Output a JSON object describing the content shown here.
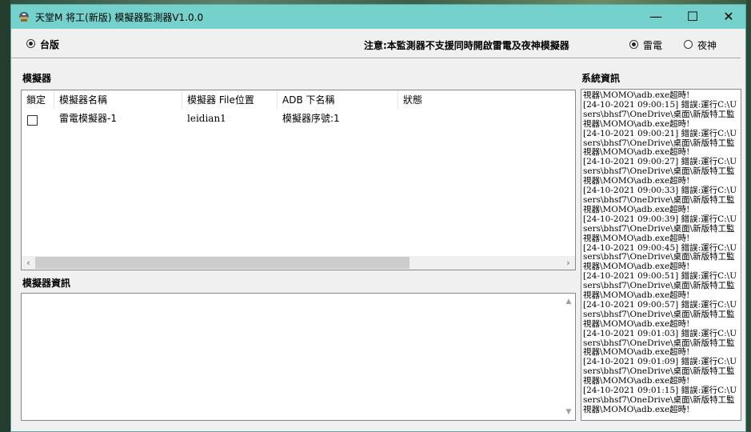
{
  "window": {
    "title": "天堂M 将工(新版) 模擬器監測器V1.0.0",
    "minimize": "—",
    "maximize": "☐",
    "close": "✕"
  },
  "region": {
    "option_taiwan": "台版",
    "notice": "注意:本監測器不支援同時開啟雷電及夜神模擬器",
    "option_leidian": "雷電",
    "option_nox": "夜神"
  },
  "emulator_section": {
    "title": "模擬器",
    "columns": [
      "鎖定",
      "模擬器名稱",
      "模擬器 File位置",
      "ADB 下名稱",
      "狀態"
    ],
    "rows": [
      {
        "locked": false,
        "name": "雷電模擬器-1",
        "file": "leidian1",
        "adb": "模擬器序號:1",
        "status": ""
      }
    ]
  },
  "emulator_info": {
    "title": "模擬器資訊",
    "content": ""
  },
  "system_info": {
    "title": "系統資訊",
    "log": "視器\\MOMO\\adb.exe超時!\n[24-10-2021 09:00:15] 錯誤:運行C:\\Users\\bhsf7\\OneDrive\\桌面\\新版特工監視器\\MOMO\\adb.exe超時!\n[24-10-2021 09:00:21] 錯誤:運行C:\\Users\\bhsf7\\OneDrive\\桌面\\新版特工監視器\\MOMO\\adb.exe超時!\n[24-10-2021 09:00:27] 錯誤:運行C:\\Users\\bhsf7\\OneDrive\\桌面\\新版特工監視器\\MOMO\\adb.exe超時!\n[24-10-2021 09:00:33] 錯誤:運行C:\\Users\\bhsf7\\OneDrive\\桌面\\新版特工監視器\\MOMO\\adb.exe超時!\n[24-10-2021 09:00:39] 錯誤:運行C:\\Users\\bhsf7\\OneDrive\\桌面\\新版特工監視器\\MOMO\\adb.exe超時!\n[24-10-2021 09:00:45] 錯誤:運行C:\\Users\\bhsf7\\OneDrive\\桌面\\新版特工監視器\\MOMO\\adb.exe超時!\n[24-10-2021 09:00:51] 錯誤:運行C:\\Users\\bhsf7\\OneDrive\\桌面\\新版特工監視器\\MOMO\\adb.exe超時!\n[24-10-2021 09:00:57] 錯誤:運行C:\\Users\\bhsf7\\OneDrive\\桌面\\新版特工監視器\\MOMO\\adb.exe超時!\n[24-10-2021 09:01:03] 錯誤:運行C:\\Users\\bhsf7\\OneDrive\\桌面\\新版特工監視器\\MOMO\\adb.exe超時!\n[24-10-2021 09:01:09] 錯誤:運行C:\\Users\\bhsf7\\OneDrive\\桌面\\新版特工監視器\\MOMO\\adb.exe超時!\n[24-10-2021 09:01:15] 錯誤:運行C:\\Users\\bhsf7\\OneDrive\\桌面\\新版特工監視器\\MOMO\\adb.exe超時!"
  },
  "colors": {
    "titlebar": "#74d1cc",
    "window_bg": "#f0f0f0"
  }
}
